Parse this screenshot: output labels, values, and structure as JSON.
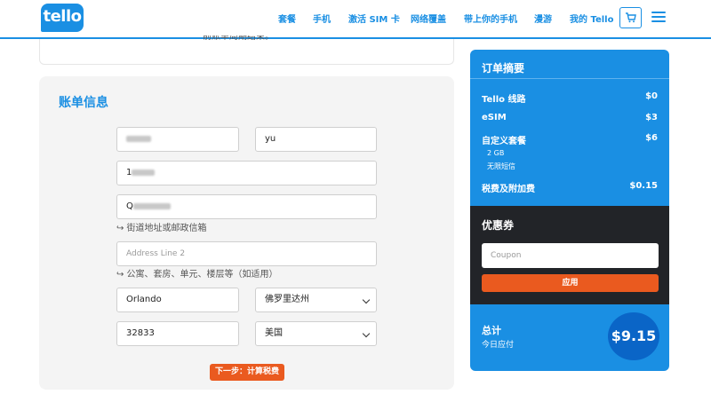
{
  "header": {
    "logo": "tello",
    "nav": [
      "套餐",
      "手机",
      "激活 SIM 卡",
      "网络覆盖",
      "带上你的手机",
      "漫游",
      "我的 Tello"
    ]
  },
  "top_card": {
    "text": "前账单周期结束。"
  },
  "billing": {
    "title": "账单信息",
    "last_name": "yu",
    "address_line1_prefix": "Q",
    "address_hint": "↪ 街道地址或邮政信箱",
    "address_line2_placeholder": "Address Line 2",
    "address_line2_hint": "↪ 公寓、套房、单元、楼层等（如适用）",
    "city": "Orlando",
    "state": "佛罗里达州",
    "zip": "32833",
    "country": "美国",
    "next_button": "下一步：计算税费"
  },
  "summary": {
    "title": "订单摘要",
    "rows": [
      {
        "label": "Tello 线路",
        "value": "$0"
      },
      {
        "label": "eSIM",
        "value": "$3"
      },
      {
        "label": "自定义套餐",
        "value": "$6"
      }
    ],
    "plan_details": [
      "2 GB",
      "无限短信"
    ],
    "tax_label": "税费及附加费",
    "tax_value": "$0.15",
    "coupon_title": "优惠券",
    "coupon_placeholder": "Coupon",
    "apply_button": "应用",
    "total_label": "总计",
    "total_sub": "今日应付",
    "total_value": "$9.15"
  },
  "colors": {
    "brand": "#1a8fe3",
    "accent": "#ea5a1f",
    "dark": "#222428"
  }
}
